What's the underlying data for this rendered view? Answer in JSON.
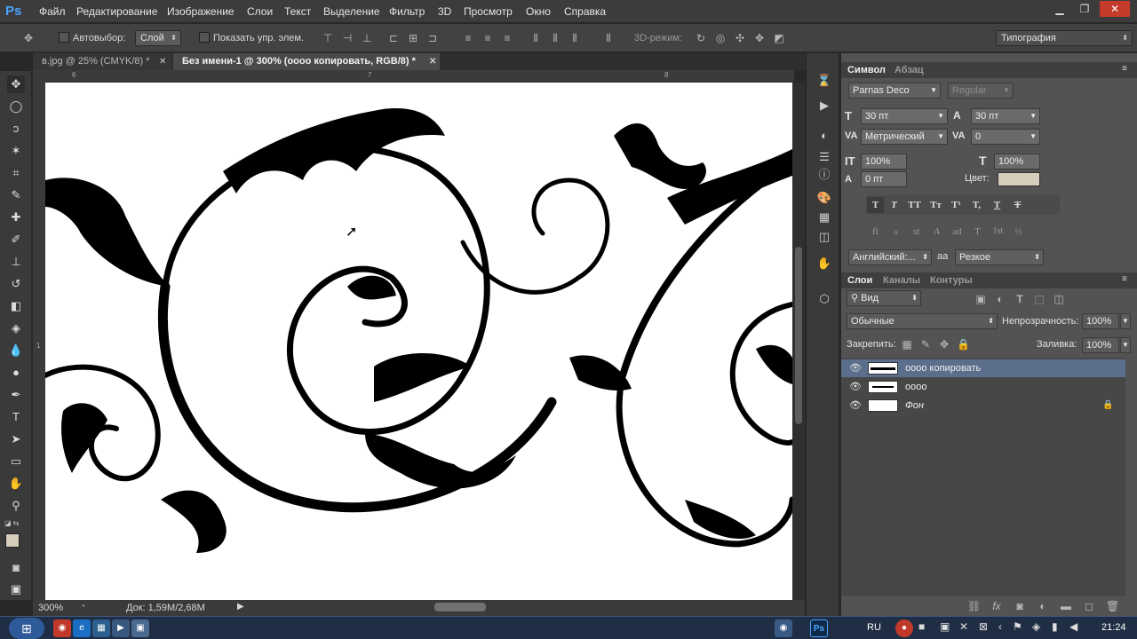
{
  "app": {
    "logo": "Ps"
  },
  "menu": [
    "Файл",
    "Редактирование",
    "Изображение",
    "Слои",
    "Текст",
    "Выделение",
    "Фильтр",
    "3D",
    "Просмотр",
    "Окно",
    "Справка"
  ],
  "window_controls": {
    "minimize": "▁",
    "restore": "❐",
    "close": "✕"
  },
  "options": {
    "autoselect_label": "Автовыбор:",
    "autoselect_value": "Слой",
    "show_controls_label": "Показать упр. элем.",
    "mode3d_label": "3D-режим:",
    "workspace": "Типография"
  },
  "tabs": [
    {
      "label": "в.jpg @ 25% (CMYK/8) *",
      "close": "✕"
    },
    {
      "label": "Без имени-1 @ 300% (оооо копировать, RGB/8) *",
      "close": "✕"
    }
  ],
  "ruler": {
    "top": [
      "6",
      "7",
      "8"
    ],
    "left": [
      "1"
    ]
  },
  "status": {
    "zoom": "300%",
    "doc": "Док: 1,59M/2,68M"
  },
  "character_panel": {
    "tabs": [
      "Символ",
      "Абзац"
    ],
    "font_family": "Parnas Deco",
    "font_style": "Regular",
    "font_size": "30 пт",
    "leading": "30 пт",
    "kerning": "Метрический",
    "tracking": "0",
    "vscale": "100%",
    "hscale": "100%",
    "baseline": "0 пт",
    "color_label": "Цвет:",
    "color_value": "#d8ccbc",
    "style_buttons": [
      "T",
      "T",
      "TT",
      "Tт",
      "T¹",
      "T,",
      "T",
      "T"
    ],
    "opentype_buttons": [
      "fi",
      "ℴ",
      "st",
      "A",
      "ad",
      "T",
      "1st",
      "½"
    ],
    "language": "Английский:...",
    "aa_label": "aa",
    "antialias": "Резкое"
  },
  "layers_panel": {
    "tabs": [
      "Слои",
      "Каналы",
      "Контуры"
    ],
    "filter": "Вид",
    "blend": "Обычные",
    "opacity_label": "Непрозрачность:",
    "opacity": "100%",
    "lock_label": "Закрепить:",
    "fill_label": "Заливка:",
    "fill": "100%",
    "layers": [
      {
        "name": "оооо копировать",
        "selected": true
      },
      {
        "name": "оооо",
        "selected": false
      },
      {
        "name": "Фон",
        "selected": false,
        "locked": true
      }
    ]
  },
  "taskbar": {
    "lang": "RU",
    "time": "21:24"
  }
}
